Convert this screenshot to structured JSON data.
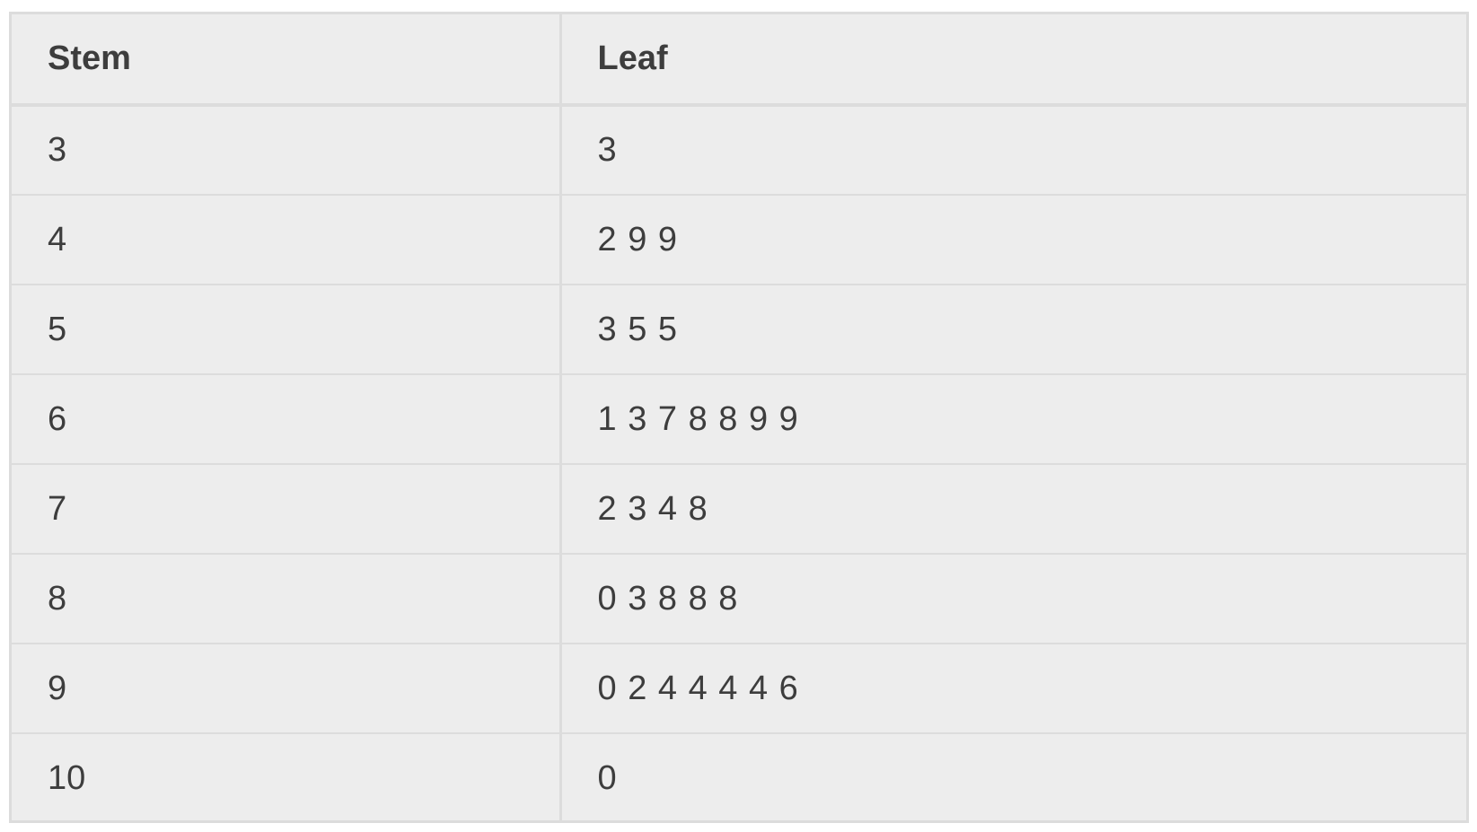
{
  "chart_data": {
    "type": "table",
    "columns": [
      "Stem",
      "Leaf"
    ],
    "rows": [
      {
        "stem": "3",
        "leaf": "3"
      },
      {
        "stem": "4",
        "leaf": "2 9 9"
      },
      {
        "stem": "5",
        "leaf": "3 5 5"
      },
      {
        "stem": "6",
        "leaf": "1 3 7 8 8 9 9"
      },
      {
        "stem": "7",
        "leaf": "2 3 4 8"
      },
      {
        "stem": "8",
        "leaf": "0 3 8 8 8"
      },
      {
        "stem": "9",
        "leaf": "0 2 4 4 4 4 6"
      },
      {
        "stem": "10",
        "leaf": "0"
      }
    ]
  },
  "colors": {
    "background": "#ededed",
    "border": "#dcdcdc",
    "text": "#3d3d3d"
  }
}
